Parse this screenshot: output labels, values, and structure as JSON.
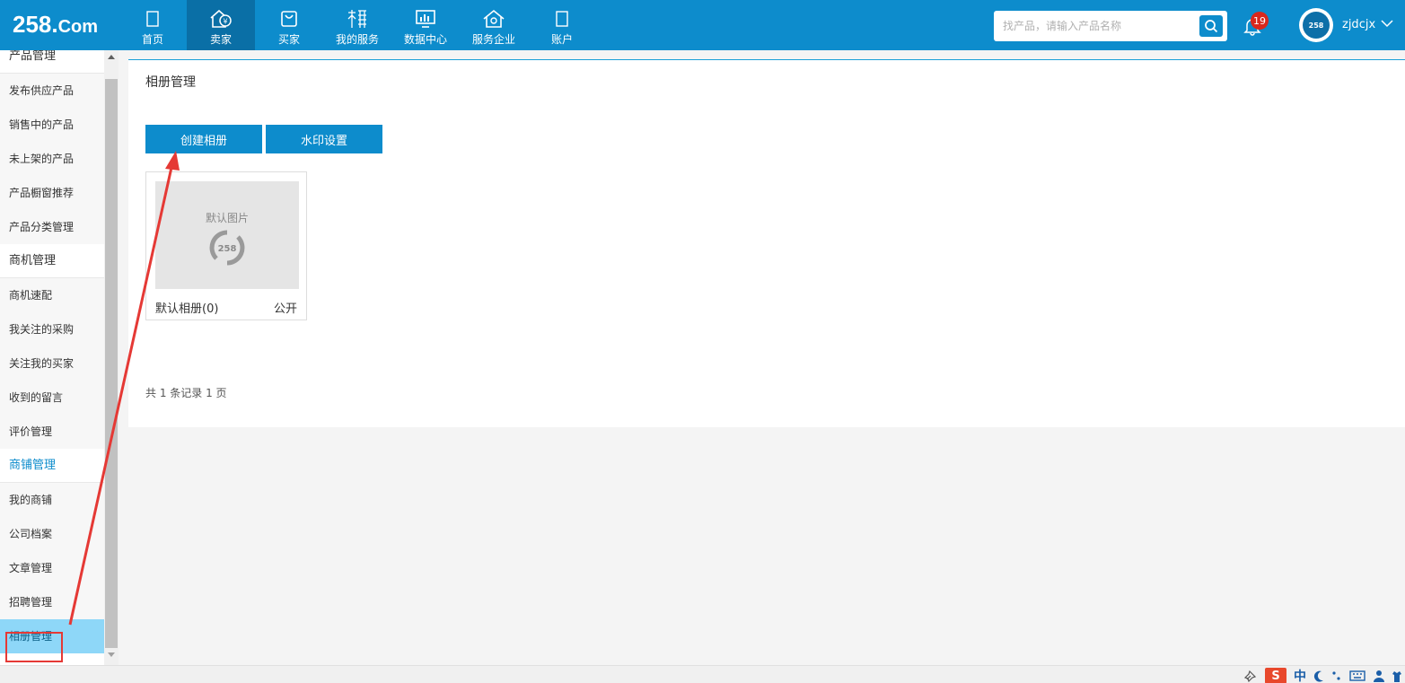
{
  "header": {
    "logo_main": "258.",
    "logo_suffix": "Com",
    "nav": [
      {
        "label": "首页",
        "icon": "home-icon"
      },
      {
        "label": "卖家",
        "icon": "seller-icon"
      },
      {
        "label": "买家",
        "icon": "shopping-bag-icon"
      },
      {
        "label": "我的服务",
        "icon": "service-icon"
      },
      {
        "label": "数据中心",
        "icon": "chart-icon"
      },
      {
        "label": "服务企业",
        "icon": "enterprise-icon"
      },
      {
        "label": "账户",
        "icon": "account-icon"
      }
    ],
    "active_nav": "卖家",
    "search_placeholder": "找产品，请输入产品名称",
    "notification_count": "19",
    "avatar_text": "258",
    "username": "zjdcjx"
  },
  "sidebar": {
    "sections": [
      {
        "title": "产品管理",
        "items": [
          "发布供应产品",
          "销售中的产品",
          "未上架的产品",
          "产品橱窗推荐",
          "产品分类管理"
        ]
      },
      {
        "title": "商机管理",
        "items": [
          "商机速配",
          "我关注的采购",
          "关注我的买家",
          "收到的留言",
          "评价管理"
        ]
      },
      {
        "title": "商铺管理",
        "items": [
          "我的商铺",
          "公司档案",
          "文章管理",
          "招聘管理",
          "相册管理"
        ]
      }
    ],
    "selected_item": "相册管理"
  },
  "main": {
    "page_title": "相册管理",
    "buttons": {
      "create": "创建相册",
      "watermark": "水印设置"
    },
    "album": {
      "thumb_text": "默认图片",
      "thumb_logo": "258",
      "name": "默认相册(0)",
      "visibility": "公开"
    },
    "records": "共 1 条记录 1 页"
  },
  "tray": {
    "ime_logo": "S",
    "ime_mode": "中"
  },
  "colors": {
    "header_bg": "#0d8ccc",
    "active_nav_bg": "#0a6fa6",
    "badge": "#d9281d",
    "selected_item_bg": "#8ed7f8",
    "annotation": "#e53935"
  }
}
